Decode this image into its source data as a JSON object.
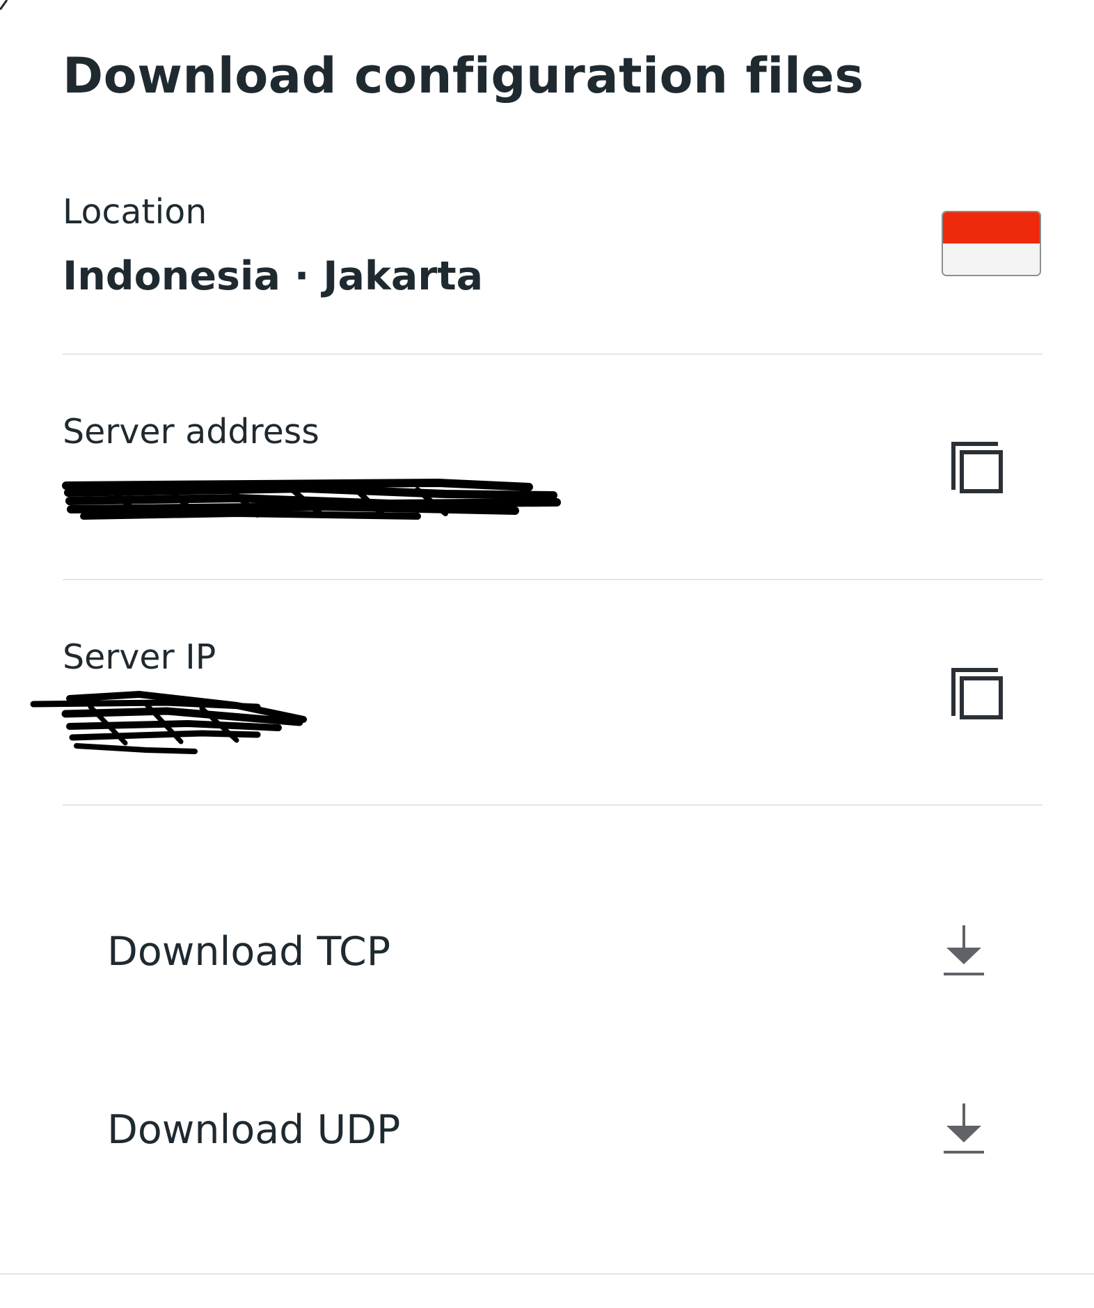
{
  "title": "Download configuration files",
  "location": {
    "label": "Location",
    "value": "Indonesia · Jakarta",
    "flag_colors": [
      "#ef2a0c",
      "#f4f4f4"
    ]
  },
  "server_address": {
    "label": "Server address",
    "copy_icon": "copy-icon"
  },
  "server_ip": {
    "label": "Server IP",
    "copy_icon": "copy-icon"
  },
  "downloads": {
    "tcp_label": "Download TCP",
    "udp_label": "Download UDP",
    "icon": "download-icon"
  }
}
